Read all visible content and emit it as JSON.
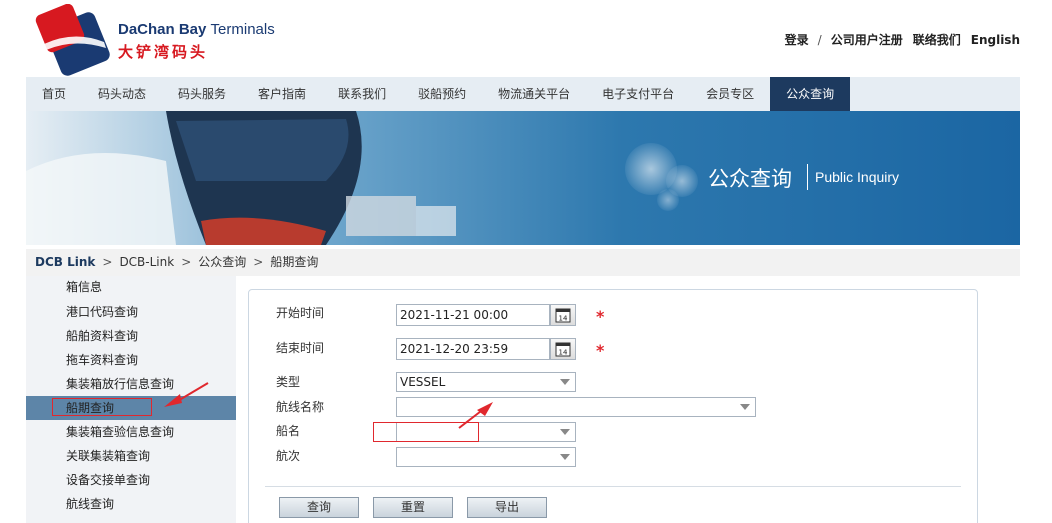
{
  "header": {
    "brand_en_bold": "DaChan Bay",
    "brand_en_light": "Terminals",
    "brand_cn": "大铲湾码头",
    "links": [
      "登录",
      "公司用户注册",
      "联络我们",
      "English"
    ],
    "sep": "/"
  },
  "nav": {
    "items": [
      "首页",
      "码头动态",
      "码头服务",
      "客户指南",
      "联系我们",
      "驳船预约",
      "物流通关平台",
      "电子支付平台",
      "会员专区",
      "公众查询"
    ],
    "active_index": 9
  },
  "banner": {
    "title": "公众查询",
    "subtitle": "Public Inquiry"
  },
  "breadcrumb": {
    "items": [
      "DCB Link",
      "DCB-Link",
      "公众查询",
      "船期查询"
    ],
    "sep": ">"
  },
  "sidebar": {
    "items": [
      "箱信息",
      "港口代码查询",
      "船舶资料查询",
      "拖车资料查询",
      "集装箱放行信息查询",
      "船期查询",
      "集装箱查验信息查询",
      "关联集装箱查询",
      "设备交接单查询",
      "航线查询"
    ],
    "active_index": 5
  },
  "form": {
    "start_label": "开始时间",
    "start_value": "2021-11-21 00:00",
    "end_label": "结束时间",
    "end_value": "2021-12-20 23:59",
    "required_mark": "*",
    "calendar_day": "14",
    "type_label": "类型",
    "type_value": "VESSEL",
    "route_label": "航线名称",
    "route_value": "",
    "vessel_label": "船名",
    "vessel_value": "",
    "voyage_label": "航次",
    "voyage_value": ""
  },
  "buttons": {
    "query": "查询",
    "reset": "重置",
    "export": "导出"
  },
  "colors": {
    "nav_active": "#1d3a5f",
    "sidebar_active": "#5d85a8",
    "annotation_red": "#e0282e",
    "brand_blue": "#1a3a72",
    "brand_red": "#d71920"
  }
}
